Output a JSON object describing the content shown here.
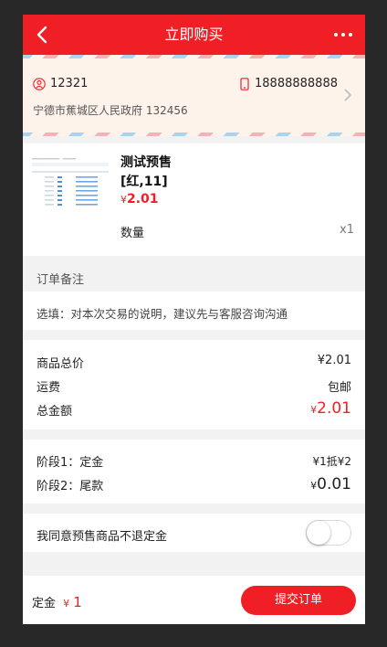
{
  "header": {
    "title": "立即购买"
  },
  "address": {
    "name": "12321",
    "phone": "18888888888",
    "detail": "宁德市蕉城区人民政府 132456"
  },
  "product": {
    "name": "测试预售",
    "spec": "[红,11]",
    "price_symbol": "¥",
    "price": "2.01",
    "qty_label": "数量",
    "qty_value": "x1"
  },
  "note": {
    "title": "订单备注",
    "placeholder": "选填：对本次交易的说明，建议先与客服咨询沟通"
  },
  "totals": {
    "goods_label": "商品总价",
    "goods_value": "¥2.01",
    "shipping_label": "运费",
    "shipping_value": "包邮",
    "total_label": "总金额",
    "total_symbol": "¥",
    "total_value": "2.01"
  },
  "stages": {
    "stage1_label": "阶段1：定金",
    "stage1_value": "¥1抵¥2",
    "stage2_label": "阶段2：尾款",
    "stage2_symbol": "¥",
    "stage2_value": "0.01"
  },
  "agree": {
    "label": "我同意预售商品不退定金",
    "checked": false
  },
  "footer": {
    "deposit_label": "定金",
    "deposit_symbol": "¥",
    "deposit_value": "1",
    "submit_label": "提交订单"
  },
  "colors": {
    "brand": "#f01f26",
    "background": "#f2f2f2"
  }
}
